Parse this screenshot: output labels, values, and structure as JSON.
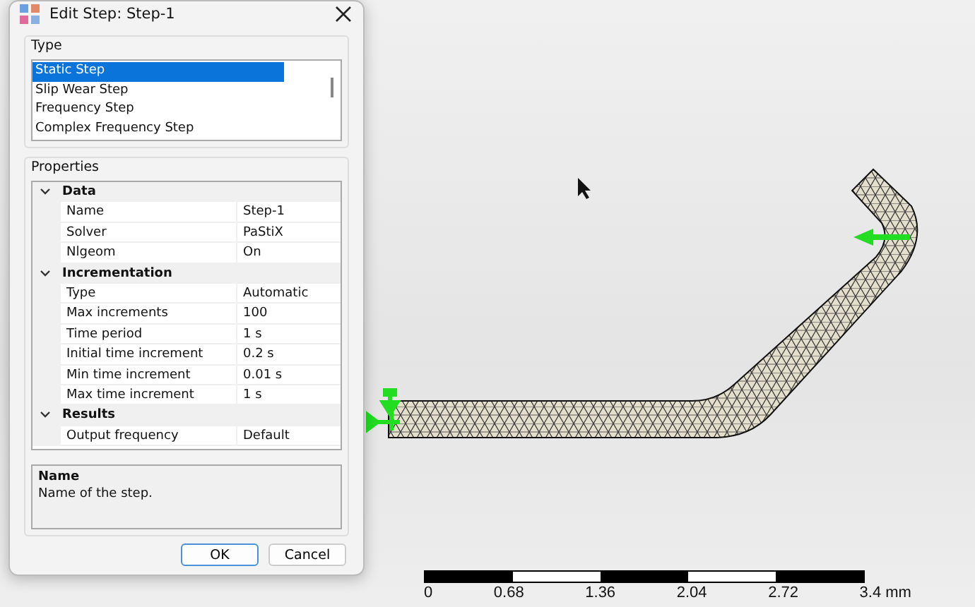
{
  "dialog": {
    "title": "Edit Step: Step-1",
    "type_group": {
      "label": "Type",
      "items": [
        {
          "label": "Static Step",
          "selected": true
        },
        {
          "label": "Slip Wear Step",
          "selected": false
        },
        {
          "label": "Frequency Step",
          "selected": false
        },
        {
          "label": "Complex Frequency Step",
          "selected": false
        }
      ]
    },
    "properties_group": {
      "label": "Properties",
      "categories": [
        {
          "name": "Data",
          "expanded": true,
          "rows": [
            {
              "name": "Name",
              "value": "Step-1"
            },
            {
              "name": "Solver",
              "value": "PaStiX"
            },
            {
              "name": "Nlgeom",
              "value": "On"
            }
          ]
        },
        {
          "name": "Incrementation",
          "expanded": true,
          "rows": [
            {
              "name": "Type",
              "value": "Automatic"
            },
            {
              "name": "Max increments",
              "value": "100"
            },
            {
              "name": "Time period",
              "value": "1 s"
            },
            {
              "name": "Initial time increment",
              "value": "0.2 s"
            },
            {
              "name": "Min time increment",
              "value": "0.01 s"
            },
            {
              "name": "Max time increment",
              "value": "1 s"
            }
          ]
        },
        {
          "name": "Results",
          "expanded": true,
          "rows": [
            {
              "name": "Output frequency",
              "value": "Default"
            }
          ]
        }
      ]
    },
    "description": {
      "title": "Name",
      "text": "Name of the step."
    },
    "buttons": [
      {
        "label": "OK",
        "default": true
      },
      {
        "label": "Cancel",
        "default": false
      }
    ]
  },
  "viewport": {
    "scale_bar": {
      "labels": [
        "0",
        "0.68",
        "1.36",
        "2.04",
        "2.72",
        "3.4 mm"
      ]
    }
  }
}
